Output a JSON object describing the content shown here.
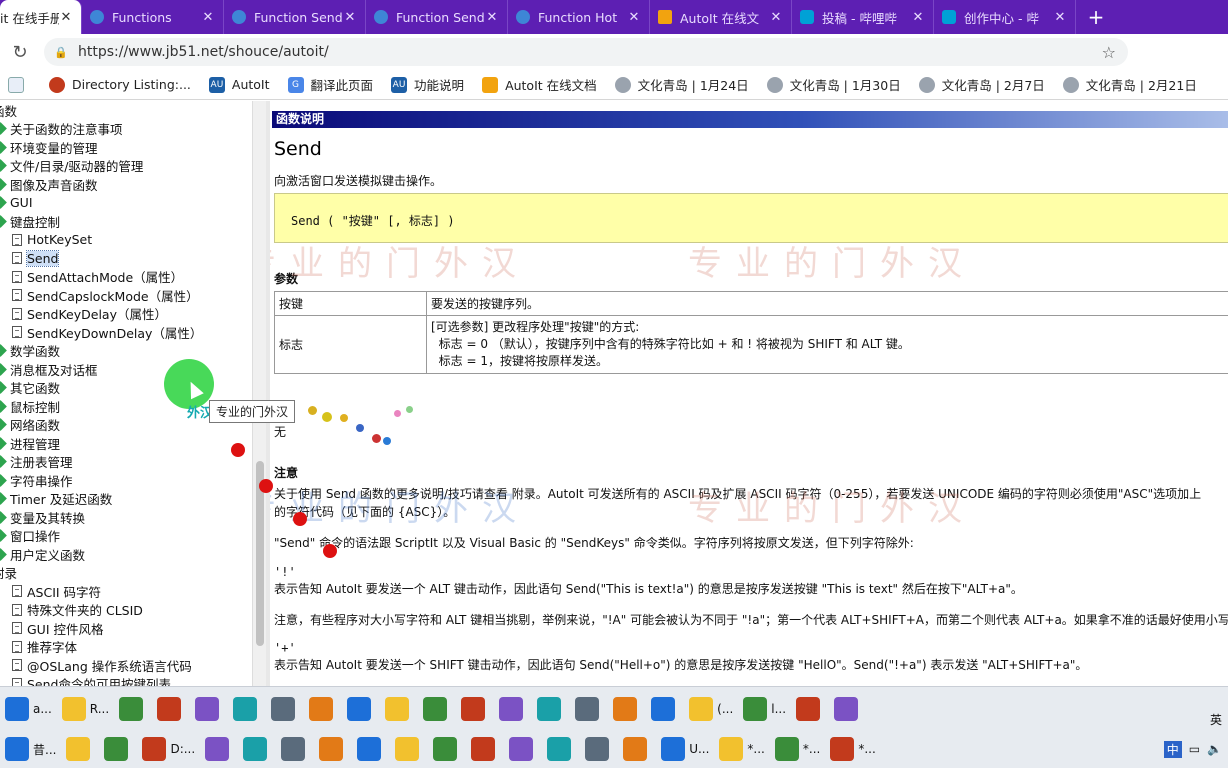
{
  "browser": {
    "tabs": [
      {
        "label": "it 在线手册",
        "icon": "page-icon",
        "active": true
      },
      {
        "label": "Functions",
        "icon": "globe-icon"
      },
      {
        "label": "Function Send",
        "icon": "globe-icon"
      },
      {
        "label": "Function Send",
        "icon": "globe-icon"
      },
      {
        "label": "Function Hot",
        "icon": "globe-icon"
      },
      {
        "label": "AutoIt 在线文",
        "icon": "autoit-icon"
      },
      {
        "label": "投稿 - 哔哩哔",
        "icon": "bilibili-icon"
      },
      {
        "label": "创作中心 - 哔",
        "icon": "bilibili-icon"
      }
    ],
    "tab_close": "✕",
    "new_tab": "+",
    "url": "https://www.jb51.net/shouce/autoit/",
    "bookmarks": [
      "Directory Listing:...",
      "AutoIt",
      "翻译此页面",
      "功能说明",
      "AutoIt 在线文档",
      "文化青岛 | 1月24日",
      "文化青岛 | 1月30日",
      "文化青岛 | 2月7日",
      "文化青岛 | 2月21日"
    ]
  },
  "tree": [
    {
      "label": "函数",
      "kind": "root"
    },
    {
      "label": "关于函数的注意事项",
      "kind": "folder"
    },
    {
      "label": "环境变量的管理",
      "kind": "folder"
    },
    {
      "label": "文件/目录/驱动器的管理",
      "kind": "folder"
    },
    {
      "label": "图像及声音函数",
      "kind": "folder"
    },
    {
      "label": "GUI",
      "kind": "folder"
    },
    {
      "label": "键盘控制",
      "kind": "folder"
    },
    {
      "label": "HotKeySet",
      "kind": "doc"
    },
    {
      "label": "Send",
      "kind": "doc",
      "selected": true
    },
    {
      "label": "SendAttachMode（属性）",
      "kind": "doc"
    },
    {
      "label": "SendCapslockMode（属性）",
      "kind": "doc"
    },
    {
      "label": "SendKeyDelay（属性）",
      "kind": "doc"
    },
    {
      "label": "SendKeyDownDelay（属性）",
      "kind": "doc"
    },
    {
      "label": "数学函数",
      "kind": "folder"
    },
    {
      "label": "消息框及对话框",
      "kind": "folder"
    },
    {
      "label": "其它函数",
      "kind": "folder"
    },
    {
      "label": "鼠标控制",
      "kind": "folder"
    },
    {
      "label": "网络函数",
      "kind": "folder"
    },
    {
      "label": "进程管理",
      "kind": "folder"
    },
    {
      "label": "注册表管理",
      "kind": "folder"
    },
    {
      "label": "字符串操作",
      "kind": "folder"
    },
    {
      "label": "Timer 及延迟函数",
      "kind": "folder"
    },
    {
      "label": "变量及其转换",
      "kind": "folder"
    },
    {
      "label": "窗口操作",
      "kind": "folder"
    },
    {
      "label": "用户定义函数",
      "kind": "folder"
    },
    {
      "label": "附录",
      "kind": "root"
    },
    {
      "label": "ASCII 码字符",
      "kind": "doc"
    },
    {
      "label": "特殊文件夹的 CLSID",
      "kind": "doc"
    },
    {
      "label": "GUI 控件风格",
      "kind": "doc"
    },
    {
      "label": "推荐字体",
      "kind": "doc"
    },
    {
      "label": "@OSLang 操作系统语言代码",
      "kind": "doc"
    },
    {
      "label": "Send命令的可用按键列表",
      "kind": "doc"
    }
  ],
  "doc": {
    "section_bar": "函数说明",
    "title": "Send",
    "description": "向激活窗口发送模拟键击操作。",
    "syntax": "Send ( \"按键\" [, 标志] )",
    "params_heading": "参数",
    "params": [
      {
        "name": "按键",
        "desc": [
          "要发送的按键序列。"
        ]
      },
      {
        "name": "标志",
        "desc": [
          "[可选参数] 更改程序处理\"按键\"的方式:",
          "  标志 = 0 （默认），按键序列中含有的特殊字符比如 + 和 ! 将被视为 SHIFT 和 ALT 键。",
          "  标志 = 1，按键将按原样发送。"
        ]
      }
    ],
    "return_value": "无",
    "notes_heading": "注意",
    "notes_line1": "关于使用 Send 函数的更多说明/技巧请查看 附录。AutoIt 可发送所有的 ASCII 码及扩展 ASCII 码字符（0-255），若要发送 UNICODE 编码的字符则必须使用\"ASC\"选项加上",
    "notes_line2": "的字符代码（见下面的 {ASC}）。",
    "notes_line3": "\"Send\" 命令的语法跟 ScriptIt 以及 Visual Basic 的 \"SendKeys\" 命令类似。字符序列将按原文发送，但下列字符除外:",
    "bang_symbol": "'!'",
    "bang_desc": "表示告知 AutoIt 要发送一个 ALT 键击动作，因此语句 Send(\"This is text!a\") 的意思是按序发送按键 \"This is text\" 然后在按下\"ALT+a\"。",
    "case_note": "注意，有些程序对大小写字符和 ALT 键相当挑剔，举例来说，\"!A\" 可能会被认为不同于 \"!a\"；第一个代表 ALT+SHIFT+A，而第二个则代表 ALT+a。如果拿不准的话最好使用小写",
    "plus_symbol": "'+'",
    "plus_desc": "表示告知 AutoIt 要发送一个 SHIFT 键击动作，因此语句 Send(\"Hell+o\") 的意思是按序发送按键 \"HellO\"。Send(\"!+a\") 表示发送 \"ALT+SHIFT+a\"。"
  },
  "overlay": {
    "tooltip": "专业的门外汉",
    "brand": "外汉",
    "watermark": "专业的门外汉"
  },
  "taskbar": {
    "row1": [
      "a...",
      "R...",
      "",
      "",
      "",
      "",
      "",
      "",
      "",
      "",
      "",
      "",
      "",
      "",
      "",
      "",
      "",
      "(...",
      "l...",
      "",
      ""
    ],
    "row2": [
      "昔...",
      "",
      "",
      "D:...",
      "",
      "",
      "",
      "",
      "",
      "",
      "",
      "",
      "",
      "",
      "",
      "",
      "U...",
      "*...",
      "*...",
      "*..."
    ],
    "tray_text": "英",
    "tray_ime": "中"
  },
  "colors": {
    "tab_strip": "#5d1fb3",
    "section_bar": "#0a0a78",
    "syntax_bg": "#ffffa8",
    "tree_icon": "#2da44e",
    "halo": "#28d23c"
  }
}
